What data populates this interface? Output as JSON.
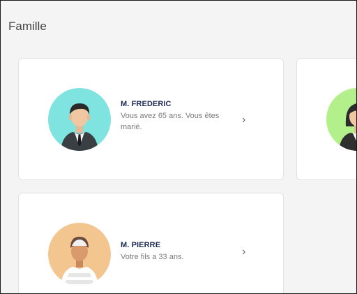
{
  "section": {
    "title": "Famille"
  },
  "members": [
    {
      "name": "M. FREDERIC",
      "description": "Vous avez 65 ans. Vous êtes marié.",
      "avatar_icon": "man-in-suit-avatar-icon",
      "avatar_color": "#7fe3e0"
    },
    {
      "name": "",
      "description": "",
      "avatar_icon": "woman-avatar-icon",
      "avatar_color": "#b3f08c"
    },
    {
      "name": "M. PIERRE",
      "description": "Votre fils a 33 ans.",
      "avatar_icon": "young-man-cap-avatar-icon",
      "avatar_color": "#f3c58f"
    }
  ],
  "chevron_icon": "chevron-right-icon",
  "chevron_glyph": "›"
}
